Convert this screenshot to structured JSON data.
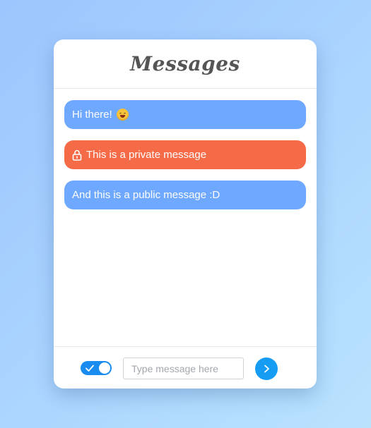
{
  "header": {
    "title": "Messages"
  },
  "messages": [
    {
      "text": "Hi there!",
      "type": "public",
      "emoji": "hugging-face-emoji"
    },
    {
      "text": "This is a private message",
      "type": "private",
      "icon": "lock-icon"
    },
    {
      "text": "And this is a public message :D",
      "type": "public"
    }
  ],
  "composer": {
    "toggle": {
      "state": "on",
      "icon": "checkmark-icon"
    },
    "input_placeholder": "Type message here",
    "input_value": "",
    "send_icon": "chevron-right-icon"
  },
  "colors": {
    "public_bubble": "#6fa8ff",
    "private_bubble": "#f56a47",
    "accent": "#169cf2",
    "toggle": "#1a8cf0"
  }
}
